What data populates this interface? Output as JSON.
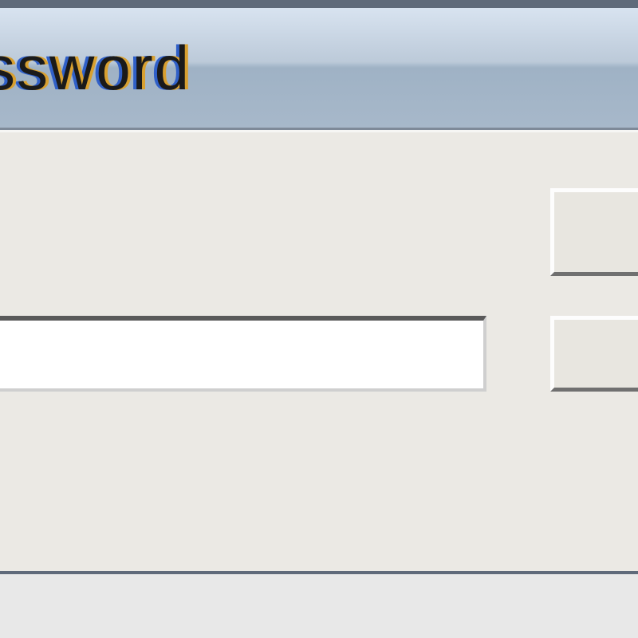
{
  "window": {
    "title_visible_fragment": "ssword"
  },
  "form": {
    "password_value": "",
    "password_placeholder": ""
  },
  "buttons": {
    "top_label": "",
    "bottom_label": ""
  }
}
